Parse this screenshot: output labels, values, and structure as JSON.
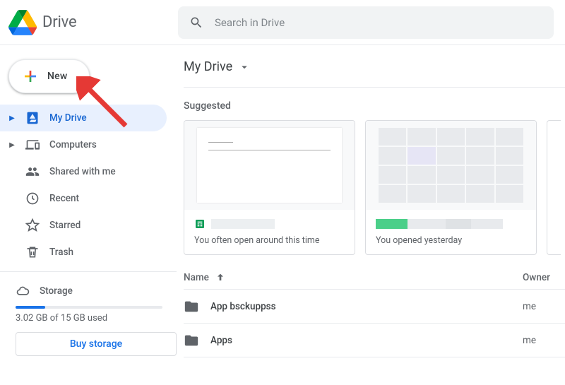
{
  "header": {
    "app_name": "Drive",
    "search_placeholder": "Search in Drive"
  },
  "sidebar": {
    "new_label": "New",
    "items": [
      {
        "id": "my-drive",
        "label": "My Drive",
        "icon": "drive-icon",
        "active": true,
        "expandable": true
      },
      {
        "id": "computers",
        "label": "Computers",
        "icon": "devices-icon",
        "active": false,
        "expandable": true
      },
      {
        "id": "shared",
        "label": "Shared with me",
        "icon": "people-icon",
        "active": false,
        "expandable": false
      },
      {
        "id": "recent",
        "label": "Recent",
        "icon": "clock-icon",
        "active": false,
        "expandable": false
      },
      {
        "id": "starred",
        "label": "Starred",
        "icon": "star-icon",
        "active": false,
        "expandable": false
      },
      {
        "id": "trash",
        "label": "Trash",
        "icon": "trash-icon",
        "active": false,
        "expandable": false
      }
    ],
    "storage_label": "Storage",
    "storage_used_text": "3.02 GB of 15 GB used",
    "storage_fill_percent": 20,
    "buy_storage_label": "Buy storage"
  },
  "main": {
    "breadcrumb": "My Drive",
    "suggested_title": "Suggested",
    "cards": [
      {
        "icon": "sheets-icon",
        "subtitle": "You often open around this time"
      },
      {
        "icon": "sheets-icon",
        "subtitle": "You opened yesterday"
      }
    ],
    "columns": {
      "name": "Name",
      "owner": "Owner"
    },
    "rows": [
      {
        "name": "App bsckuppss",
        "owner": "me"
      },
      {
        "name": "Apps",
        "owner": "me"
      }
    ]
  }
}
